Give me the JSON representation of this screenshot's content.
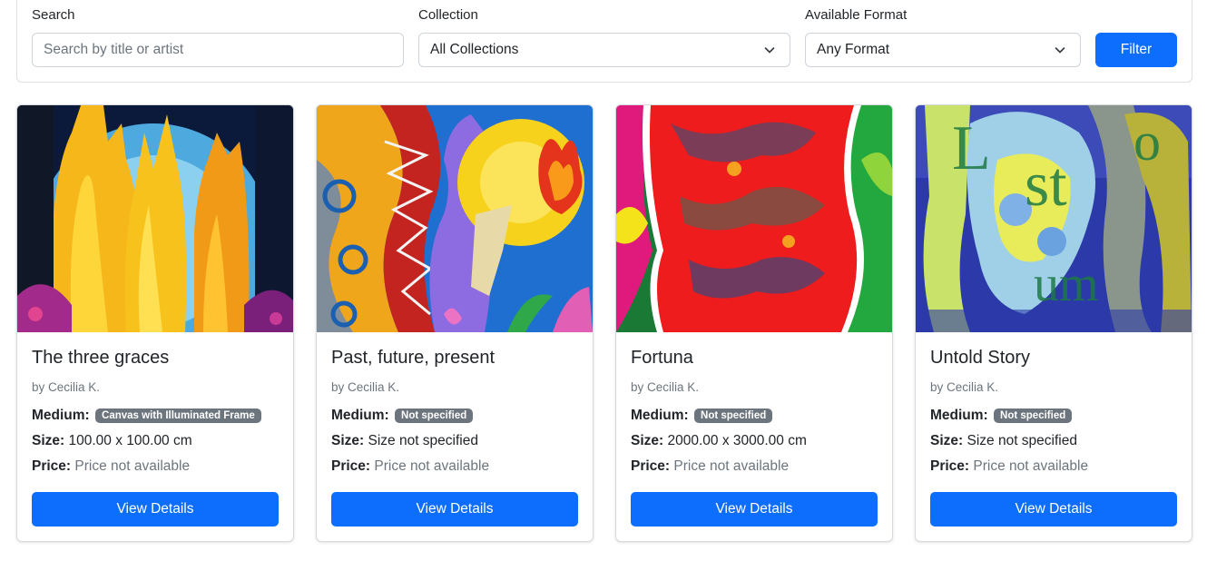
{
  "filters": {
    "search": {
      "label": "Search",
      "placeholder": "Search by title or artist"
    },
    "collection": {
      "label": "Collection",
      "selected": "All Collections"
    },
    "format": {
      "label": "Available Format",
      "selected": "Any Format"
    },
    "filter_button": "Filter"
  },
  "artworks": [
    {
      "title": "The three graces",
      "artist": "by Cecilia K.",
      "medium_label": "Medium:",
      "medium": "Canvas with Illuminated Frame",
      "size_label": "Size:",
      "size": "100.00 x 100.00 cm",
      "price_label": "Price:",
      "price": "Price not available",
      "button": "View Details"
    },
    {
      "title": "Past, future, present",
      "artist": "by Cecilia K.",
      "medium_label": "Medium:",
      "medium": "Not specified",
      "size_label": "Size:",
      "size": "Size not specified",
      "price_label": "Price:",
      "price": "Price not available",
      "button": "View Details"
    },
    {
      "title": "Fortuna",
      "artist": "by Cecilia K.",
      "medium_label": "Medium:",
      "medium": "Not specified",
      "size_label": "Size:",
      "size": "2000.00 x 3000.00 cm",
      "price_label": "Price:",
      "price": "Price not available",
      "button": "View Details"
    },
    {
      "title": "Untold Story",
      "artist": "by Cecilia K.",
      "medium_label": "Medium:",
      "medium": "Not specified",
      "size_label": "Size:",
      "size": "Size not specified",
      "price_label": "Price:",
      "price": "Price not available",
      "button": "View Details"
    }
  ],
  "colors": {
    "primary": "#0d6efd",
    "badge": "#6c757d",
    "muted_text": "#6c757d"
  },
  "icons": {
    "select_caret": "chevron-down-icon"
  }
}
